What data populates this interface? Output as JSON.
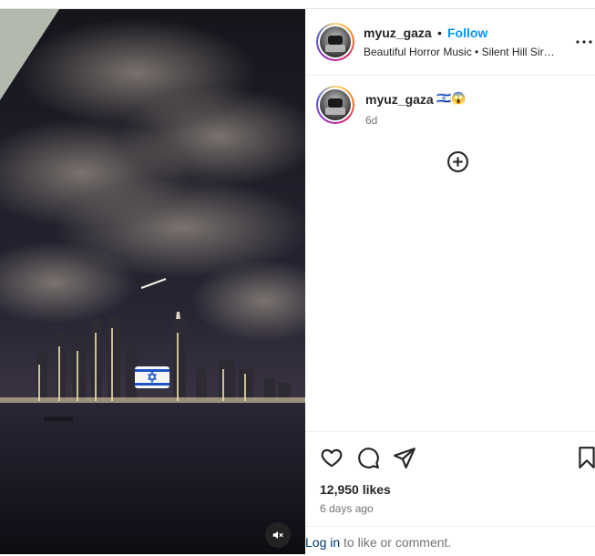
{
  "post": {
    "username": "myuz_gaza",
    "separator": "•",
    "follow_label": "Follow",
    "audio": "Beautiful Horror Music • Silent Hill Sir…",
    "caption_emoji": "🇮🇱😱",
    "caption_age": "6d",
    "likes": "12,950 likes",
    "date": "6 days ago"
  },
  "comment_box": {
    "login_link": "Log in",
    "login_suffix": " to like or comment."
  },
  "icons": {
    "more": "more-dots-icon",
    "load_more": "plus-circle-icon",
    "like": "heart-icon",
    "comment": "comment-icon",
    "share": "send-icon",
    "save": "bookmark-icon",
    "mute": "speaker-muted-icon"
  },
  "colors": {
    "accent": "#0095f6",
    "link": "#00376b",
    "muted_text": "#737373"
  }
}
